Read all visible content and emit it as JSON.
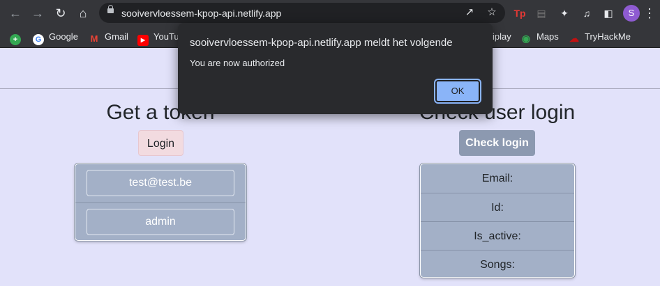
{
  "browser": {
    "url": "sooivervloessem-kpop-api.netlify.app",
    "profile_initial": "S",
    "bookmarks": [
      {
        "label": "",
        "icon": "add-bookmark-icon",
        "color": "#34a853"
      },
      {
        "label": "Google",
        "icon": "google-icon",
        "color": "#ea4335"
      },
      {
        "label": "Gmail",
        "icon": "gmail-icon",
        "color": "#ea4335"
      },
      {
        "label": "YouTu",
        "icon": "youtube-icon",
        "color": "#ff0000"
      },
      {
        "label": "iplay",
        "icon": "",
        "color": ""
      },
      {
        "label": "Maps",
        "icon": "maps-icon",
        "color": "#34a853"
      },
      {
        "label": "TryHackMe",
        "icon": "tryhackme-icon",
        "color": "#c11111"
      }
    ]
  },
  "dialog": {
    "title": "sooivervloessem-kpop-api.netlify.app meldt het volgende",
    "message": "You are now authorized",
    "ok_label": "OK"
  },
  "page": {
    "left": {
      "heading": "Get a token",
      "button_label": "Login",
      "email": "test@test.be",
      "password": "admin"
    },
    "right": {
      "heading": "Check user login",
      "button_label": "Check login",
      "fields": [
        "Email:",
        "Id:",
        "Is_active:",
        "Songs:"
      ]
    }
  },
  "colors": {
    "page_bg": "#e2e2fa",
    "card_bg": "#a3b0c7",
    "login_button": "#f2dbe0",
    "check_button": "#8c99b0",
    "dialog_bg": "#292a2d",
    "ok_button": "#8ab4f8"
  }
}
